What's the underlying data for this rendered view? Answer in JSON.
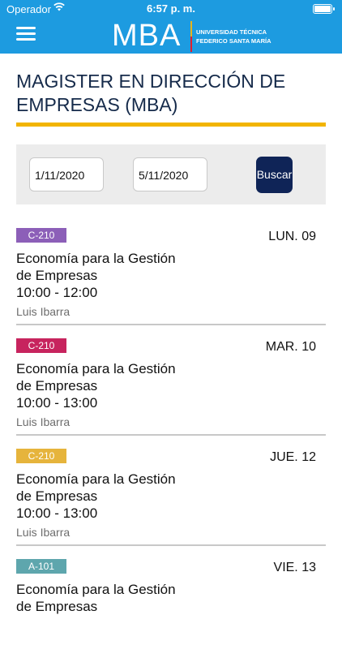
{
  "status_bar": {
    "carrier": "Operador",
    "time": "6:57 p. m."
  },
  "header": {
    "logo_text": "MBA",
    "institution_line1": "UNIVERSIDAD TÉCNICA",
    "institution_line2": "FEDERICO SANTA MARÍA",
    "brand_color": "#1d9be0"
  },
  "page": {
    "title": "MAGISTER EN DIRECCIÓN DE EMPRESAS (MBA)",
    "accent_color": "#f2b400"
  },
  "filter": {
    "date_from": "1/11/2020",
    "date_to": "5/11/2020",
    "search_label": "Buscar"
  },
  "schedule": [
    {
      "room": "C-210",
      "room_color": "#8c5fb8",
      "day": "LUN. 09",
      "course": "Economía para la Gestión de Empresas",
      "hours": "10:00 - 12:00",
      "teacher": "Luis Ibarra"
    },
    {
      "room": "C-210",
      "room_color": "#c7245e",
      "day": "MAR. 10",
      "course": "Economía para la Gestión de Empresas",
      "hours": "10:00 - 13:00",
      "teacher": "Luis Ibarra"
    },
    {
      "room": "C-210",
      "room_color": "#e6b43c",
      "day": "JUE. 12",
      "course": "Economía para la Gestión de Empresas",
      "hours": "10:00 - 13:00",
      "teacher": "Luis Ibarra"
    },
    {
      "room": "A-101",
      "room_color": "#5ea6ad",
      "day": "VIE. 13",
      "course": "Economía para la Gestión de Empresas",
      "hours": "",
      "teacher": ""
    }
  ]
}
